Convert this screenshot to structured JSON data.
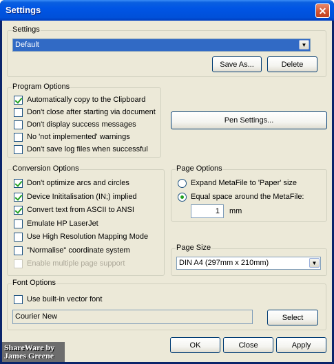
{
  "window": {
    "title": "Settings",
    "close_glyph": "✕"
  },
  "settings_group": {
    "label": "Settings",
    "selected": "Default",
    "save_as": "Save As...",
    "delete": "Delete"
  },
  "program_options": {
    "label": "Program Options",
    "items": [
      {
        "label": "Automatically copy to the Clipboard",
        "checked": true
      },
      {
        "label": "Don't close after starting via document",
        "checked": false
      },
      {
        "label": "Don't display success messages",
        "checked": false
      },
      {
        "label": "No 'not implemented' warnings",
        "checked": false
      },
      {
        "label": "Don't save log files when successful",
        "checked": false
      }
    ]
  },
  "pen_settings": "Pen Settings...",
  "conversion_options": {
    "label": "Conversion Options",
    "items": [
      {
        "label": "Don't optimize arcs and circles",
        "checked": true
      },
      {
        "label": "Device Inititalisation (IN;) implied",
        "checked": true
      },
      {
        "label": "Convert text from ASCII to ANSI",
        "checked": true
      },
      {
        "label": "Emulate HP LaserJet",
        "checked": false
      },
      {
        "label": "Use High Resolution Mapping Mode",
        "checked": false
      },
      {
        "label": "\"Normalise\" coordinate system",
        "checked": false
      },
      {
        "label": "Enable multiple page support",
        "checked": false,
        "disabled": true
      }
    ]
  },
  "page_options": {
    "label": "Page Options",
    "expand": "Expand MetaFile to 'Paper' size",
    "equal": "Equal space around the MetaFile:",
    "selected": "equal",
    "space_value": "1",
    "unit": "mm"
  },
  "page_size": {
    "label": "Page Size",
    "selected": "DIN A4 (297mm x 210mm)"
  },
  "font_options": {
    "label": "Font Options",
    "builtin": "Use built-in vector font",
    "builtin_checked": false,
    "font_name": "Courier New",
    "select": "Select"
  },
  "footer": {
    "ok": "OK",
    "close": "Close",
    "apply": "Apply"
  },
  "watermark": {
    "line1": "ShareWare by",
    "line2": "James Greene"
  },
  "colors": {
    "title_bar": "#0055e5",
    "dialog_bg": "#ece9d8",
    "button_border": "#003c74",
    "check": "#21a121"
  }
}
